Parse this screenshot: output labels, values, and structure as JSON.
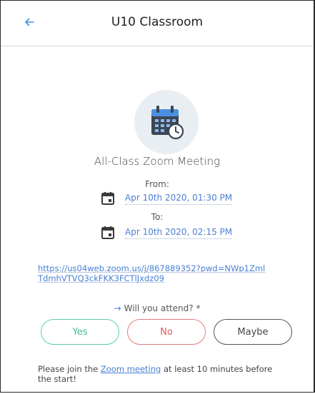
{
  "header": {
    "title": "U10 Classroom",
    "back_icon": "arrow-left-icon"
  },
  "meeting": {
    "icon": "calendar-clock-icon",
    "title": "All-Class Zoom Meeting",
    "from_label": "From:",
    "from_value": "Apr 10th 2020, 01:30 PM",
    "to_label": "To:",
    "to_value": "Apr 10th 2020, 02:15 PM",
    "link": "https://us04web.zoom.us/j/867889352?pwd=NWp1ZmlTdmhVTVQ3ckFKK3FCTlJxdz09"
  },
  "attend": {
    "question": "Will you attend? *",
    "options": {
      "yes": "Yes",
      "no": "No",
      "maybe": "Maybe"
    }
  },
  "footer": {
    "before": "Please join the ",
    "link": "Zoom meeting",
    "after": " at least 10 minutes before the start!"
  },
  "colors": {
    "accent": "#4a7fd4",
    "yes": "#3fbf8f",
    "no": "#e05a5a",
    "maybe": "#444444"
  }
}
